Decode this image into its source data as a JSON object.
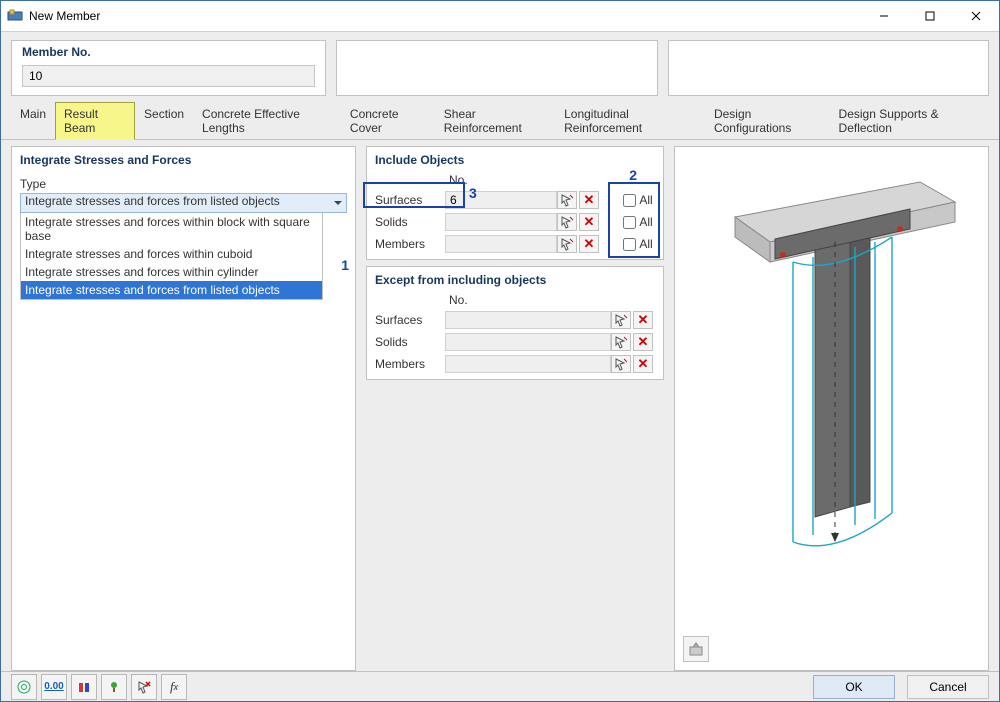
{
  "window": {
    "title": "New Member"
  },
  "header": {
    "label": "Member No.",
    "value": "10"
  },
  "tabs": [
    "Main",
    "Result Beam",
    "Section",
    "Concrete Effective Lengths",
    "Concrete Cover",
    "Shear Reinforcement",
    "Longitudinal Reinforcement",
    "Design Configurations",
    "Design Supports & Deflection"
  ],
  "active_tab": 1,
  "integrate": {
    "title": "Integrate Stresses and Forces",
    "type_label": "Type",
    "selected": "Integrate stresses and forces from listed objects",
    "options": [
      "Integrate stresses and forces within block with square base",
      "Integrate stresses and forces within cuboid",
      "Integrate stresses and forces within cylinder",
      "Integrate stresses and forces from listed objects"
    ]
  },
  "include": {
    "title": "Include Objects",
    "col_no": "No.",
    "all": "All",
    "rows": [
      {
        "label": "Surfaces",
        "value": "6"
      },
      {
        "label": "Solids",
        "value": ""
      },
      {
        "label": "Members",
        "value": ""
      }
    ]
  },
  "except": {
    "title": "Except from including objects",
    "col_no": "No.",
    "rows": [
      {
        "label": "Surfaces",
        "value": ""
      },
      {
        "label": "Solids",
        "value": ""
      },
      {
        "label": "Members",
        "value": ""
      }
    ]
  },
  "annotations": {
    "a1": "1",
    "a2": "2",
    "a3": "3"
  },
  "buttons": {
    "ok": "OK",
    "cancel": "Cancel"
  }
}
